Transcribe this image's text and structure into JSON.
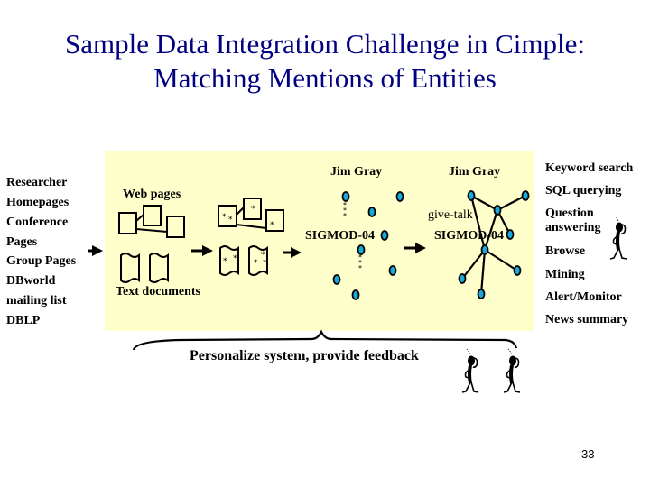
{
  "slide": {
    "title_line1": "Sample Data Integration Challenge in Cimple:",
    "title_line2": "Matching Mentions of Entities",
    "page_number": "33",
    "title_color": "#000080",
    "panel_color": "#ffffcc",
    "node_color": "#1aa7d9"
  },
  "sources": [
    "Researcher",
    "Homepages",
    "Conference",
    "Pages",
    "Group Pages",
    "DBworld",
    "mailing list",
    "DBLP"
  ],
  "pipeline": {
    "web_pages_label": "Web pages",
    "text_documents_label": "Text documents",
    "mention_marker": "*",
    "entity_graph_before": {
      "entity1": "Jim Gray",
      "entity2": "SIGMOD-04"
    },
    "entity_graph_after": {
      "entity1": "Jim Gray",
      "entity2": "SIGMOD-04",
      "relation": "give-talk"
    }
  },
  "uses": [
    "Keyword search",
    "SQL querying",
    "Question answering",
    "Browse",
    "Mining",
    "Alert/Monitor",
    "News summary"
  ],
  "feedback_label": "Personalize system, provide feedback",
  "icons": {
    "arrow": "right-arrow-icon",
    "person": "thinking-person-icon"
  }
}
